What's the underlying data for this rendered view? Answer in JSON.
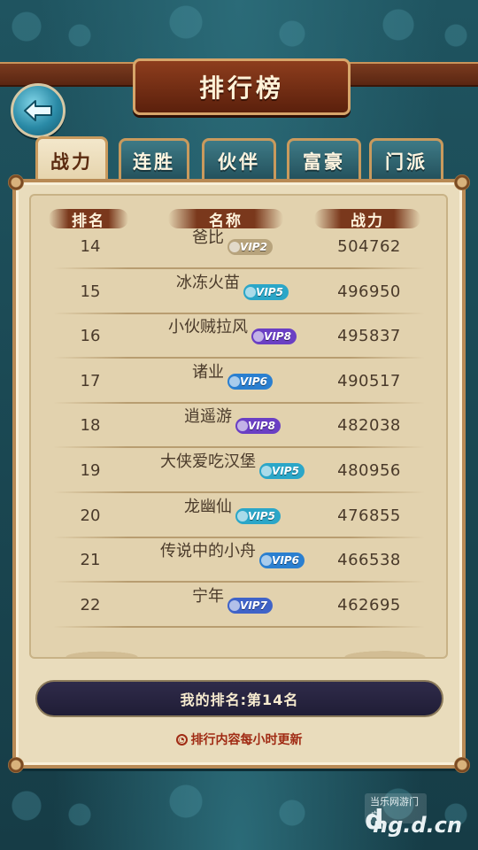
{
  "title": "排行榜",
  "tabs": [
    {
      "label": "战力",
      "active": true
    },
    {
      "label": "连胜",
      "active": false
    },
    {
      "label": "伙伴",
      "active": false
    },
    {
      "label": "富豪",
      "active": false
    },
    {
      "label": "门派",
      "active": false
    }
  ],
  "headers": {
    "rank": "排名",
    "name": "名称",
    "power": "战力"
  },
  "rows": [
    {
      "rank": "14",
      "name": "爸比",
      "vip": "VIP2",
      "power": "504762"
    },
    {
      "rank": "15",
      "name": "冰冻火苗",
      "vip": "VIP5",
      "power": "496950"
    },
    {
      "rank": "16",
      "name": "小伙贼拉风",
      "vip": "VIP8",
      "power": "495837"
    },
    {
      "rank": "17",
      "name": "诸业",
      "vip": "VIP6",
      "power": "490517"
    },
    {
      "rank": "18",
      "name": "逍遥游",
      "vip": "VIP8",
      "power": "482038"
    },
    {
      "rank": "19",
      "name": "大侠爱吃汉堡",
      "vip": "VIP5",
      "power": "480956"
    },
    {
      "rank": "20",
      "name": "龙幽仙",
      "vip": "VIP5",
      "power": "476855"
    },
    {
      "rank": "21",
      "name": "传说中的小舟",
      "vip": "VIP6",
      "power": "466538"
    },
    {
      "rank": "22",
      "name": "宁年",
      "vip": "VIP7",
      "power": "462695"
    }
  ],
  "my_rank": "我的排名:第14名",
  "refresh_note": "排行内容每小时更新",
  "watermark": {
    "top": "当乐网游门户",
    "main": "ng.d.cn",
    "logo": "d"
  },
  "colors": {
    "VIP2": "#b7a37c",
    "VIP5": "#2ba6c8",
    "VIP6": "#2a7fd0",
    "VIP7": "#3f63c8",
    "VIP8": "#6a3fc4"
  }
}
